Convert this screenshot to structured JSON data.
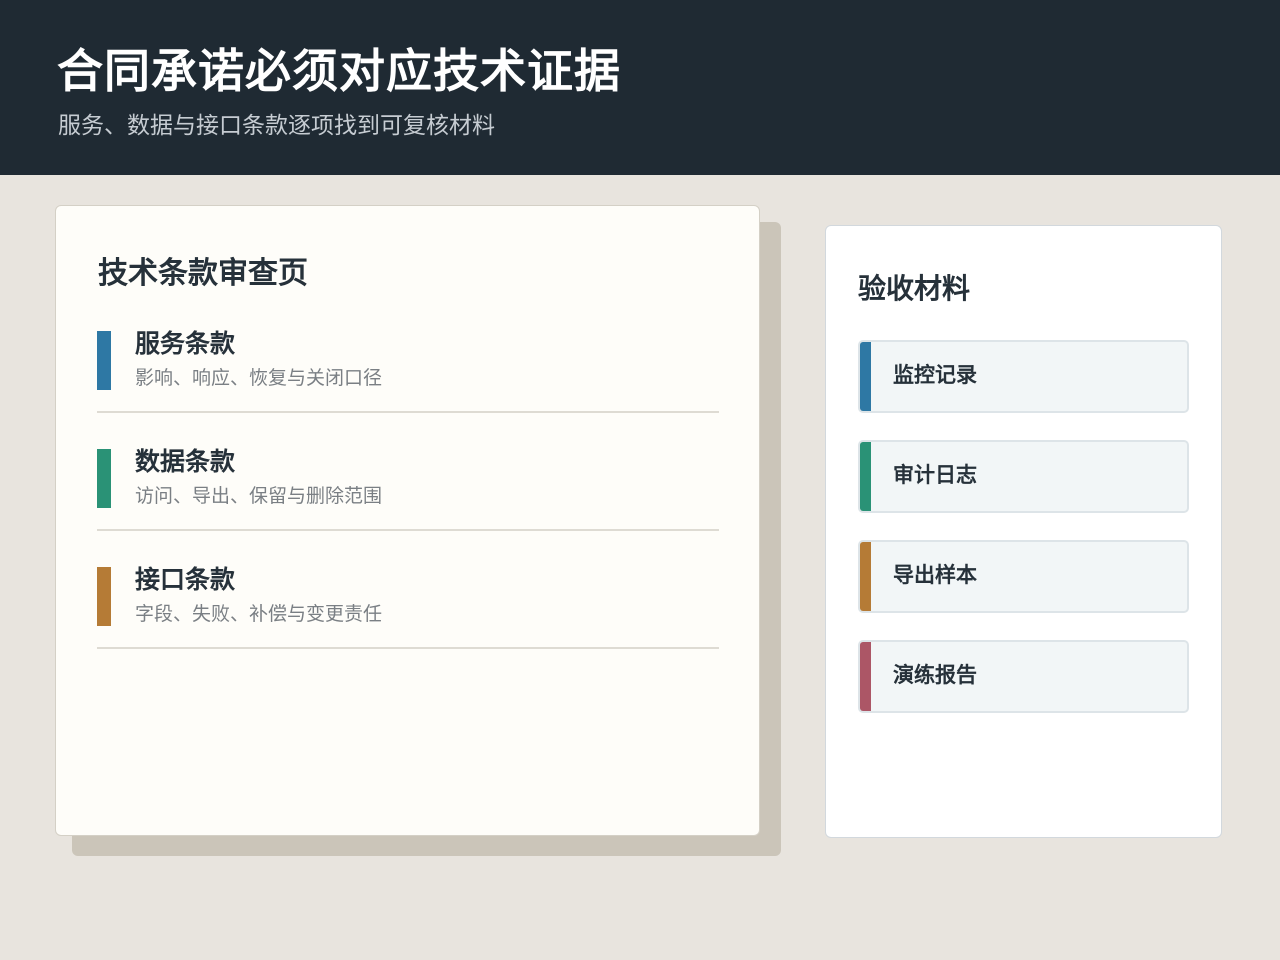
{
  "header": {
    "title": "合同承诺必须对应技术证据",
    "subtitle": "服务、数据与接口条款逐项找到可复核材料"
  },
  "review": {
    "title": "技术条款审查页",
    "clauses": [
      {
        "title": "服务条款",
        "desc": "影响、响应、恢复与关闭口径",
        "color": "#2e78a4"
      },
      {
        "title": "数据条款",
        "desc": "访问、导出、保留与删除范围",
        "color": "#2a9276"
      },
      {
        "title": "接口条款",
        "desc": "字段、失败、补偿与变更责任",
        "color": "#b57b36"
      }
    ]
  },
  "materials": {
    "title": "验收材料",
    "items": [
      {
        "label": "监控记录",
        "color": "#2e78a4"
      },
      {
        "label": "审计日志",
        "color": "#2a9276"
      },
      {
        "label": "导出样本",
        "color": "#b57b36"
      },
      {
        "label": "演练报告",
        "color": "#ac5666"
      }
    ]
  }
}
